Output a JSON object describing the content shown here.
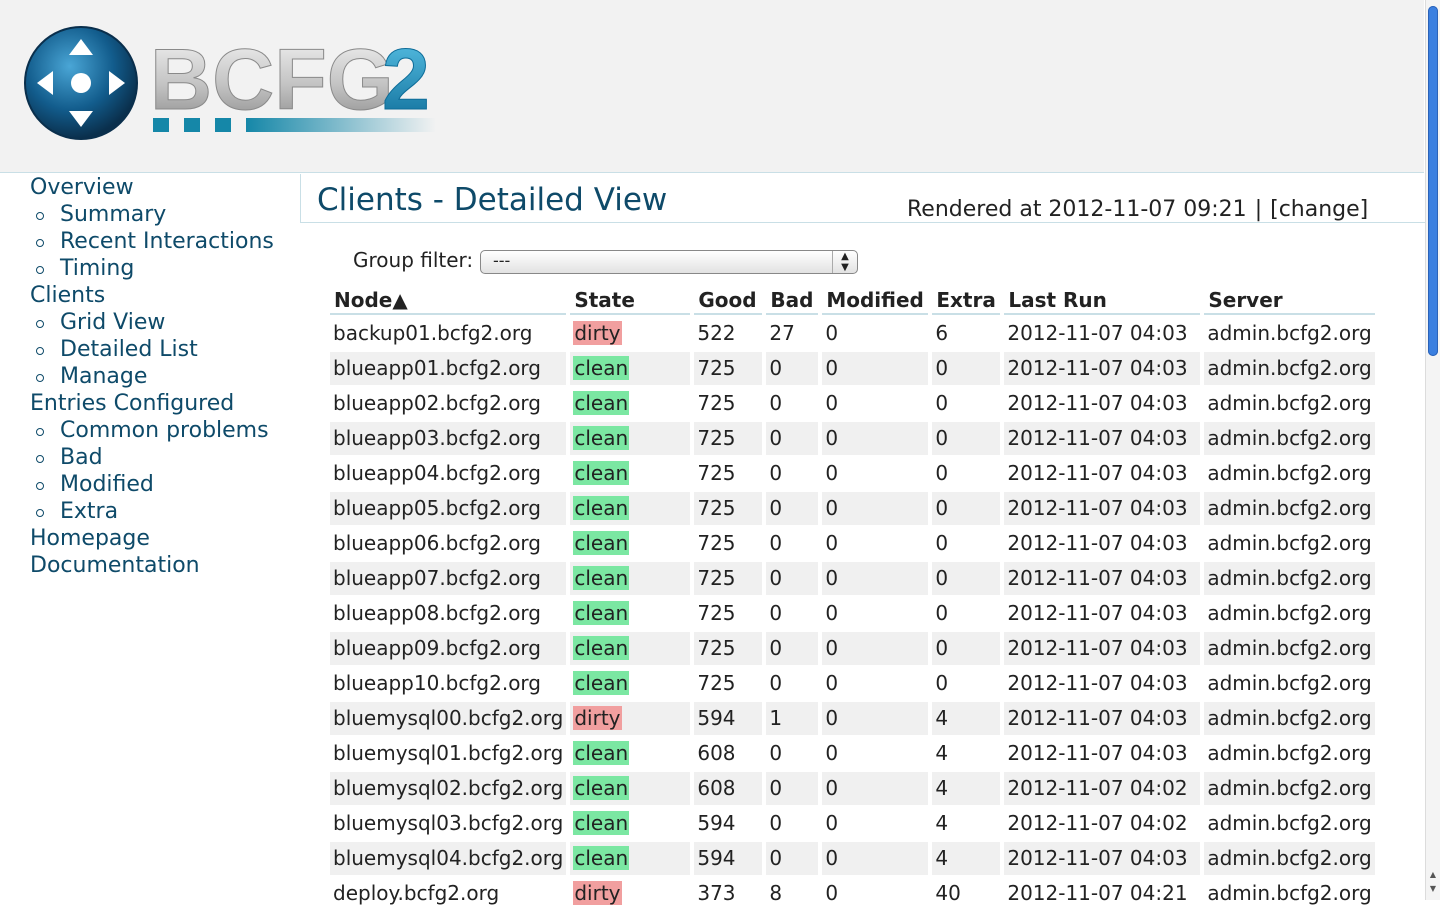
{
  "header": {
    "logo_text": "BCFG2"
  },
  "sidebar": {
    "items": [
      {
        "label": "Overview",
        "level": "top"
      },
      {
        "label": "Summary",
        "level": "sub"
      },
      {
        "label": "Recent Interactions",
        "level": "sub"
      },
      {
        "label": "Timing",
        "level": "sub"
      },
      {
        "label": "Clients",
        "level": "top"
      },
      {
        "label": "Grid View",
        "level": "sub"
      },
      {
        "label": "Detailed List",
        "level": "sub"
      },
      {
        "label": "Manage",
        "level": "sub"
      },
      {
        "label": "Entries Configured",
        "level": "top"
      },
      {
        "label": "Common problems",
        "level": "sub"
      },
      {
        "label": "Bad",
        "level": "sub"
      },
      {
        "label": "Modified",
        "level": "sub"
      },
      {
        "label": "Extra",
        "level": "sub"
      },
      {
        "label": "Homepage",
        "level": "top"
      },
      {
        "label": "Documentation",
        "level": "top"
      }
    ]
  },
  "main": {
    "title": "Clients - Detailed View",
    "rendered_prefix": "Rendered at 2012-11-07 09:21",
    "rendered_separator": "|",
    "change_link": "[change]",
    "filter": {
      "label": "Group filter:",
      "value": "---"
    },
    "table": {
      "headers": {
        "node": "Node▲",
        "state": "State",
        "good": "Good",
        "bad": "Bad",
        "modified": "Modified",
        "extra": "Extra",
        "last_run": "Last Run",
        "server": "Server"
      },
      "rows": [
        {
          "node": "backup01.bcfg2.org",
          "state": "dirty",
          "good": "522",
          "bad": "27",
          "modified": "0",
          "extra": "6",
          "last_run": "2012-11-07 04:03",
          "server": "admin.bcfg2.org"
        },
        {
          "node": "blueapp01.bcfg2.org",
          "state": "clean",
          "good": "725",
          "bad": "0",
          "modified": "0",
          "extra": "0",
          "last_run": "2012-11-07 04:03",
          "server": "admin.bcfg2.org"
        },
        {
          "node": "blueapp02.bcfg2.org",
          "state": "clean",
          "good": "725",
          "bad": "0",
          "modified": "0",
          "extra": "0",
          "last_run": "2012-11-07 04:03",
          "server": "admin.bcfg2.org"
        },
        {
          "node": "blueapp03.bcfg2.org",
          "state": "clean",
          "good": "725",
          "bad": "0",
          "modified": "0",
          "extra": "0",
          "last_run": "2012-11-07 04:03",
          "server": "admin.bcfg2.org"
        },
        {
          "node": "blueapp04.bcfg2.org",
          "state": "clean",
          "good": "725",
          "bad": "0",
          "modified": "0",
          "extra": "0",
          "last_run": "2012-11-07 04:03",
          "server": "admin.bcfg2.org"
        },
        {
          "node": "blueapp05.bcfg2.org",
          "state": "clean",
          "good": "725",
          "bad": "0",
          "modified": "0",
          "extra": "0",
          "last_run": "2012-11-07 04:03",
          "server": "admin.bcfg2.org"
        },
        {
          "node": "blueapp06.bcfg2.org",
          "state": "clean",
          "good": "725",
          "bad": "0",
          "modified": "0",
          "extra": "0",
          "last_run": "2012-11-07 04:03",
          "server": "admin.bcfg2.org"
        },
        {
          "node": "blueapp07.bcfg2.org",
          "state": "clean",
          "good": "725",
          "bad": "0",
          "modified": "0",
          "extra": "0",
          "last_run": "2012-11-07 04:03",
          "server": "admin.bcfg2.org"
        },
        {
          "node": "blueapp08.bcfg2.org",
          "state": "clean",
          "good": "725",
          "bad": "0",
          "modified": "0",
          "extra": "0",
          "last_run": "2012-11-07 04:03",
          "server": "admin.bcfg2.org"
        },
        {
          "node": "blueapp09.bcfg2.org",
          "state": "clean",
          "good": "725",
          "bad": "0",
          "modified": "0",
          "extra": "0",
          "last_run": "2012-11-07 04:03",
          "server": "admin.bcfg2.org"
        },
        {
          "node": "blueapp10.bcfg2.org",
          "state": "clean",
          "good": "725",
          "bad": "0",
          "modified": "0",
          "extra": "0",
          "last_run": "2012-11-07 04:03",
          "server": "admin.bcfg2.org"
        },
        {
          "node": "bluemysql00.bcfg2.org",
          "state": "dirty",
          "good": "594",
          "bad": "1",
          "modified": "0",
          "extra": "4",
          "last_run": "2012-11-07 04:03",
          "server": "admin.bcfg2.org"
        },
        {
          "node": "bluemysql01.bcfg2.org",
          "state": "clean",
          "good": "608",
          "bad": "0",
          "modified": "0",
          "extra": "4",
          "last_run": "2012-11-07 04:03",
          "server": "admin.bcfg2.org"
        },
        {
          "node": "bluemysql02.bcfg2.org",
          "state": "clean",
          "good": "608",
          "bad": "0",
          "modified": "0",
          "extra": "4",
          "last_run": "2012-11-07 04:02",
          "server": "admin.bcfg2.org"
        },
        {
          "node": "bluemysql03.bcfg2.org",
          "state": "clean",
          "good": "594",
          "bad": "0",
          "modified": "0",
          "extra": "4",
          "last_run": "2012-11-07 04:02",
          "server": "admin.bcfg2.org"
        },
        {
          "node": "bluemysql04.bcfg2.org",
          "state": "clean",
          "good": "594",
          "bad": "0",
          "modified": "0",
          "extra": "4",
          "last_run": "2012-11-07 04:03",
          "server": "admin.bcfg2.org"
        },
        {
          "node": "deploy.bcfg2.org",
          "state": "dirty",
          "good": "373",
          "bad": "8",
          "modified": "0",
          "extra": "40",
          "last_run": "2012-11-07 04:21",
          "server": "admin.bcfg2.org"
        }
      ]
    }
  },
  "colors": {
    "accent": "#0e4a69",
    "clean": "#7be7a2",
    "dirty": "#f19f9f",
    "header_bg": "#f2f2f2",
    "border": "#c9dfe6"
  }
}
